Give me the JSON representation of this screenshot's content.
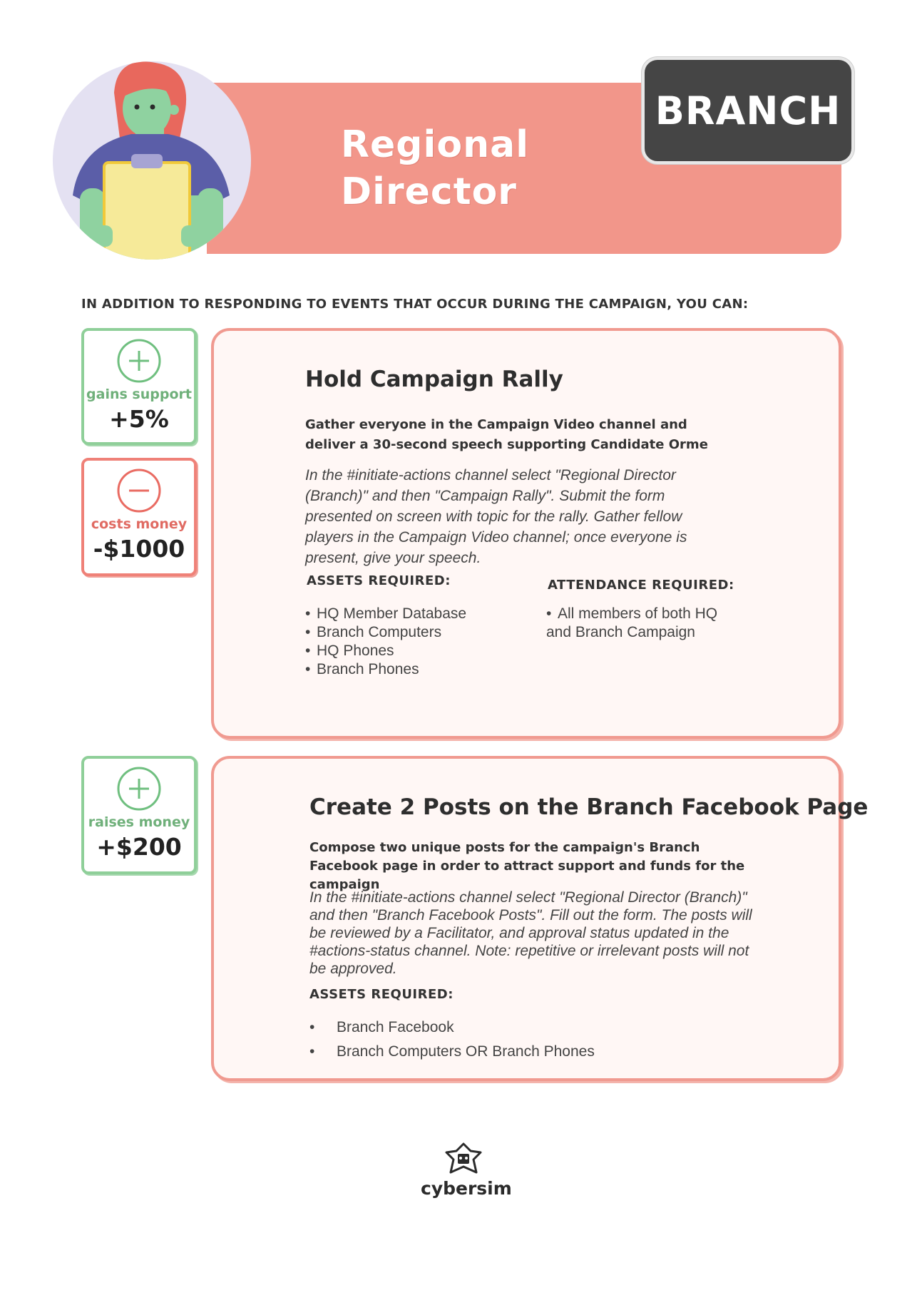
{
  "header": {
    "title_line1": "Regional",
    "title_line2": "Director",
    "badge": "BRANCH"
  },
  "intro": "IN ADDITION TO RESPONDING TO EVENTS THAT OCCUR DURING THE CAMPAIGN, YOU CAN:",
  "actions": [
    {
      "title": "Hold Campaign Rally",
      "summary": "Gather everyone in the Campaign Video channel and deliver a 30-second speech supporting Candidate Orme",
      "instructions": "In the #initiate-actions channel select \"Regional Director (Branch)\" and then \"Campaign Rally\". Submit the form presented on screen with topic for the rally. Gather fellow players in the Campaign Video channel; once everyone is present, give your speech.",
      "assets_heading": "ASSETS REQUIRED:",
      "assets": [
        "HQ Member Database",
        "Branch Computers",
        "HQ Phones",
        "Branch Phones"
      ],
      "attendance_heading": "ATTENDANCE REQUIRED:",
      "attendance_line1": "All members of both HQ",
      "attendance_line2": "and Branch Campaign",
      "effects": [
        {
          "label": "gains support",
          "value": "+5%",
          "icon": "plus-circle-icon",
          "color": "#8fcf99"
        },
        {
          "label": "costs money",
          "value": "-$1000",
          "icon": "minus-circle-icon",
          "color": "#ef8178"
        }
      ]
    },
    {
      "title": "Create 2 Posts on the Branch Facebook Page",
      "summary": "Compose two unique posts for the campaign's Branch Facebook page in order to attract support and funds for the campaign",
      "instructions": "In the #initiate-actions channel select \"Regional Director (Branch)\" and then \"Branch Facebook  Posts\". Fill out the form. The posts will be reviewed by a Facilitator, and approval status updated in the #actions-status channel. Note: repetitive or irrelevant posts will not be approved.",
      "assets_heading": "ASSETS REQUIRED:",
      "assets": [
        "Branch Facebook",
        "Branch Computers OR Branch Phones"
      ],
      "effects": [
        {
          "label": "raises money",
          "value": "+$200",
          "icon": "plus-circle-icon",
          "color": "#8fcf99"
        }
      ]
    }
  ],
  "footer": {
    "logo_text": "cybersim",
    "logo_icon": "cybersim-logo-icon"
  },
  "colors": {
    "banner": "#f2968a",
    "badge": "#454545",
    "panel_border": "#f09a90",
    "panel_bg": "#fff7f5",
    "positive": "#8fcf99",
    "negative": "#ef8178"
  }
}
